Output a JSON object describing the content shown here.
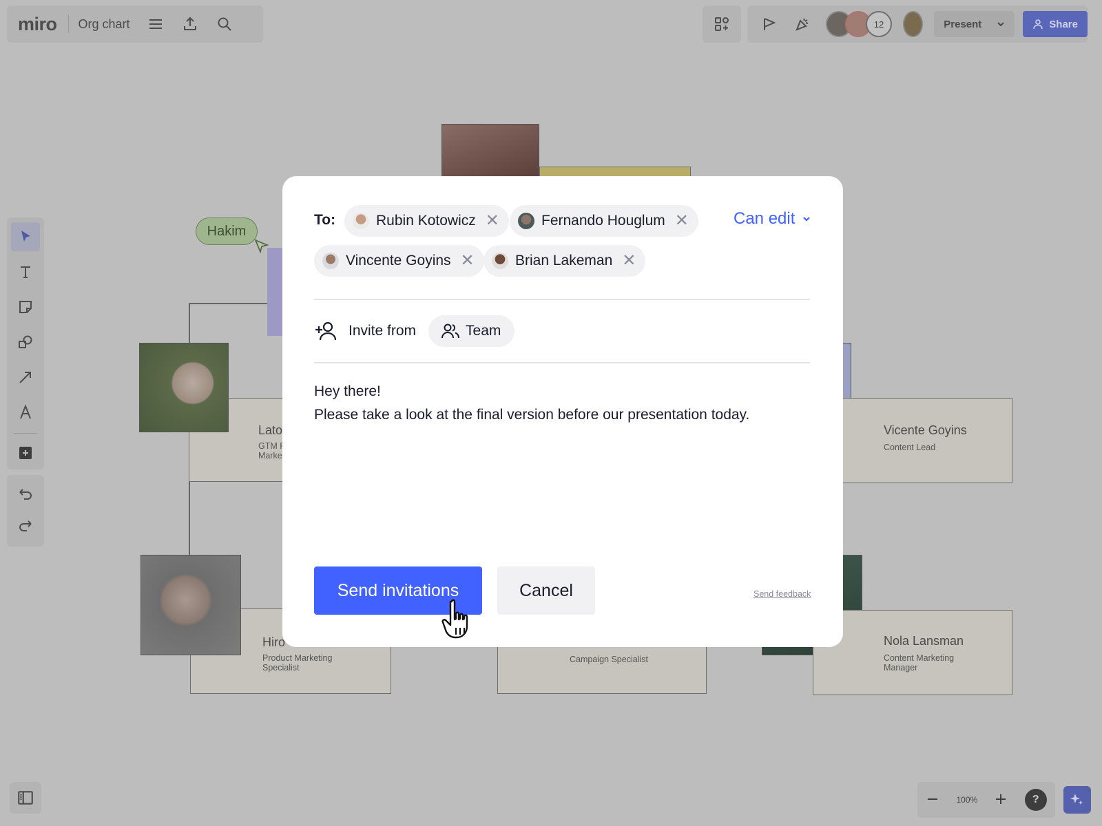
{
  "header": {
    "logo": "miro",
    "board_name": "Org chart",
    "collaborator_count": "12",
    "present_label": "Present",
    "share_label": "Share"
  },
  "canvas": {
    "bubble_label": "Hakim",
    "cards": [
      {
        "name": "Lato",
        "role": "GTM F\nMarke"
      },
      {
        "name": "Vicente Goyins",
        "role": "Content Lead"
      },
      {
        "name": "Hiro",
        "role": "Product Marketing\nSpecialist"
      },
      {
        "name": "",
        "role": "Campaign Specialist"
      },
      {
        "name": "Nola Lansman",
        "role": "Content Marketing\nManager"
      }
    ]
  },
  "zoom": {
    "level": "100%",
    "help": "?"
  },
  "dialog": {
    "to_label": "To:",
    "recipients": [
      {
        "name": "Rubin Kotowicz"
      },
      {
        "name": "Fernando Houglum"
      },
      {
        "name": "Vincente Goyins"
      },
      {
        "name": "Brian Lakeman"
      }
    ],
    "remove_glyph": "✕",
    "permission": "Can edit",
    "invite_from_label": "Invite from",
    "team_label": "Team",
    "message_line1": "Hey there!",
    "message_line2": "Please take a look at the final version before our presentation today.",
    "send_label": "Send invitations",
    "cancel_label": "Cancel",
    "feedback_label": "Send feedback"
  },
  "colors": {
    "accent": "#4262ff",
    "overlay": "#bdbdbd",
    "modal_bg": "#ffffff"
  }
}
